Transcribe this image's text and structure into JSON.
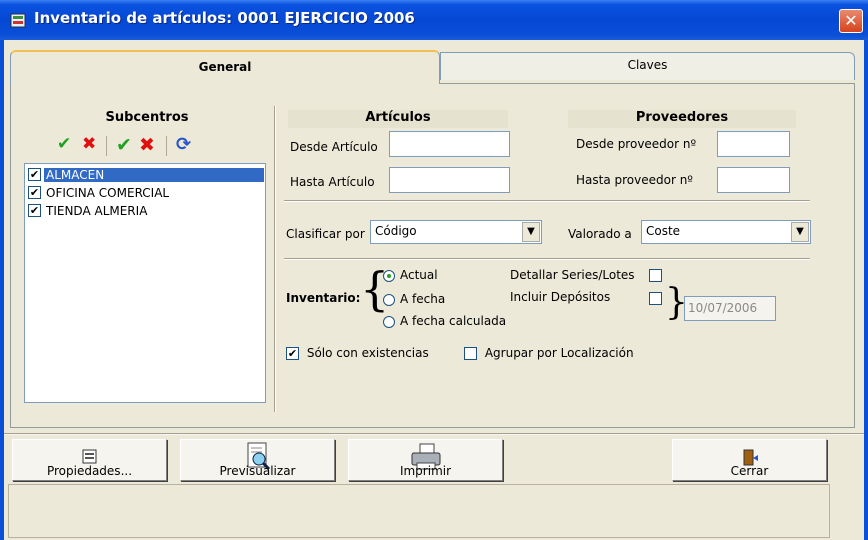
{
  "window": {
    "title": "Inventario de artículos: 0001 EJERCICIO 2006",
    "close": "✕"
  },
  "tabs": [
    {
      "label": "General"
    },
    {
      "label": "Claves"
    }
  ],
  "subcentros": {
    "title": "Subcentros",
    "toolbar": [
      "check-icon",
      "x-icon",
      "check-all-icon",
      "x-all-icon",
      "refresh-icon"
    ],
    "items": [
      {
        "label": "ALMACEN",
        "checked": true,
        "selected": true
      },
      {
        "label": "OFICINA COMERCIAL",
        "checked": true
      },
      {
        "label": "TIENDA ALMERIA",
        "checked": true
      }
    ]
  },
  "articulos": {
    "title": "Artículos",
    "desde_label": "Desde Artículo",
    "hasta_label": "Hasta Artículo",
    "desde_value": "",
    "hasta_value": ""
  },
  "proveedores": {
    "title": "Proveedores",
    "desde_label": "Desde proveedor nº",
    "hasta_label": "Hasta proveedor nº",
    "desde_value": "",
    "hasta_value": ""
  },
  "clasificar": {
    "label": "Clasificar por",
    "value": "Código"
  },
  "valorado": {
    "label": "Valorado a",
    "value": "Coste"
  },
  "inventario": {
    "label": "Inventario:",
    "options": [
      "Actual",
      "A fecha",
      "A fecha calculada"
    ],
    "selected": "Actual",
    "detallar_label": "Detallar Series/Lotes",
    "incluir_label": "Incluir Depósitos",
    "fecha": "10/07/2006"
  },
  "solo_existencias": {
    "label": "Sólo con existencias",
    "checked": true
  },
  "agrupar": {
    "label": "Agrupar por Localización",
    "checked": false
  },
  "buttons": {
    "propiedades": "Propiedades...",
    "previsualizar": "Previsualizar",
    "imprimir": "Imprimir",
    "cerrar": "Cerrar"
  },
  "colors": {
    "titlebar": "#0548d4",
    "selection": "#316ac5",
    "check": "#21a121",
    "x": "#e01010"
  }
}
